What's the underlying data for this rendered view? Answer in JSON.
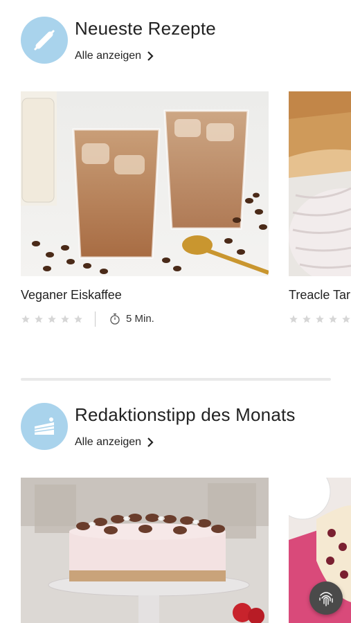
{
  "sections": [
    {
      "title": "Neueste Rezepte",
      "see_all": "Alle anzeigen",
      "icon": "rolling-pin-icon",
      "cards": [
        {
          "title": "Veganer Eiskaffee",
          "rating_stars": 5,
          "rating_filled": 0,
          "time": "5 Min."
        },
        {
          "title": "Treacle Tar",
          "rating_stars": 5,
          "rating_filled": 0
        }
      ]
    },
    {
      "title": "Redaktionstipp des Monats",
      "see_all": "Alle anzeigen",
      "icon": "cake-slice-icon"
    }
  ],
  "colors": {
    "badge": "#a9d3ec",
    "star_empty": "#d6d6d6",
    "fab": "#4a4a4a"
  },
  "fab_icon": "fingerprint-icon"
}
